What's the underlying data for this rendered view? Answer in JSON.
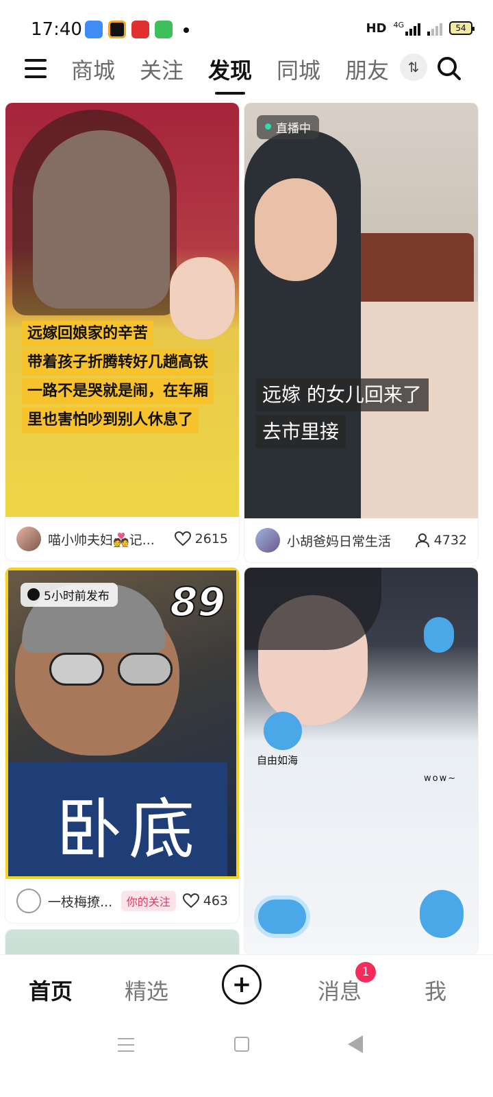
{
  "status_bar": {
    "time": "17:40",
    "network": "HD",
    "signal": "4G",
    "battery": "54"
  },
  "top_nav": {
    "tabs": [
      {
        "label": "商城"
      },
      {
        "label": "关注"
      },
      {
        "label": "发现"
      },
      {
        "label": "同城"
      },
      {
        "label": "朋友"
      }
    ],
    "active_tab": "发现"
  },
  "feed": {
    "cards": [
      {
        "caption_lines": [
          "远嫁回娘家的辛苦",
          "带着孩子折腾转好几趟高铁",
          "一路不是哭就是闹，在车厢",
          "里也害怕吵到别人休息了"
        ],
        "author": "喵小帅夫妇💑记...",
        "count": "2615",
        "count_type": "likes"
      },
      {
        "badge": "直播中",
        "caption_lines": [
          "远嫁 的女儿回来了",
          "去市里接"
        ],
        "author": "小胡爸妈日常生活",
        "count": "4732",
        "count_type": "viewers"
      },
      {
        "badge": "5小时前发布",
        "overlay_number": "89",
        "overlay_calligraphy": "卧底",
        "author": "一枝梅撩...",
        "follow_tag": "你的关注",
        "count": "463",
        "count_type": "likes"
      },
      {
        "stickers": [
          "自由如海",
          "wow~"
        ]
      }
    ]
  },
  "bottom_nav": {
    "items": [
      {
        "label": "首页"
      },
      {
        "label": "精选"
      },
      {
        "label": "消息"
      },
      {
        "label": "我"
      }
    ],
    "message_badge": "1"
  },
  "colors": {
    "accent": "#f52c5b",
    "caption_yellow": "#f8c22c",
    "follow_pink": "#e8325f"
  }
}
